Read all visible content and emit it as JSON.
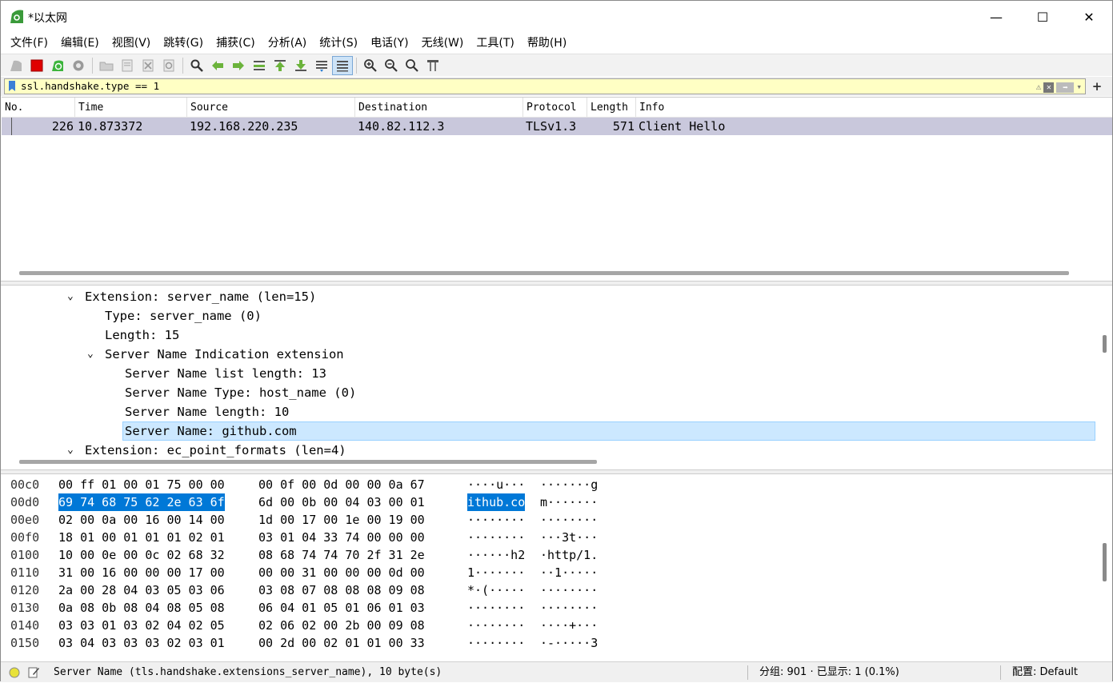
{
  "window": {
    "title": "*以太网",
    "minimize": "—",
    "maximize": "☐",
    "close": "✕"
  },
  "menu": [
    "文件(F)",
    "编辑(E)",
    "视图(V)",
    "跳转(G)",
    "捕获(C)",
    "分析(A)",
    "统计(S)",
    "电话(Y)",
    "无线(W)",
    "工具(T)",
    "帮助(H)"
  ],
  "toolbar_icons": [
    "shark-fin-icon",
    "stop-icon",
    "restart-icon",
    "options-gear-icon",
    "open-folder-icon",
    "save-file-icon",
    "close-file-icon",
    "reload-icon",
    "find-icon",
    "back-arrow-icon",
    "forward-arrow-icon",
    "goto-packet-icon",
    "first-packet-icon",
    "last-packet-icon",
    "autoscroll-icon",
    "colorize-icon",
    "zoom-in-icon",
    "zoom-out-icon",
    "zoom-normal-icon",
    "resize-columns-icon"
  ],
  "filter": {
    "value": "ssl.handshake.type == 1"
  },
  "packet_list": {
    "columns": [
      "No.",
      "Time",
      "Source",
      "Destination",
      "Protocol",
      "Length",
      "Info"
    ],
    "rows": [
      {
        "no": "226",
        "time": "10.873372",
        "source": "192.168.220.235",
        "destination": "140.82.112.3",
        "protocol": "TLSv1.3",
        "length": "571",
        "info": "Client Hello"
      }
    ]
  },
  "details": [
    {
      "text": "Extension: server_name (len=15)",
      "expanded": true
    },
    {
      "text": "Type: server_name (0)"
    },
    {
      "text": "Length: 15"
    },
    {
      "text": "Server Name Indication extension",
      "expanded": true
    },
    {
      "text": "Server Name list length: 13"
    },
    {
      "text": "Server Name Type: host_name (0)"
    },
    {
      "text": "Server Name length: 10"
    },
    {
      "text": "Server Name: github.com",
      "selected": true
    },
    {
      "text": "Extension: ec_point_formats (len=4)",
      "expanded": true
    }
  ],
  "hex": {
    "offsets": [
      "00c0",
      "00d0",
      "00e0",
      "00f0",
      "0100",
      "0110",
      "0120",
      "0130",
      "0140",
      "0150"
    ],
    "bytes1": [
      "00 ff 01 00 01 75 00 00",
      "69 74 68 75 62 2e 63 6f",
      "02 00 0a 00 16 00 14 00",
      "18 01 00 01 01 01 02 01",
      "10 00 0e 00 0c 02 68 32",
      "31 00 16 00 00 00 17 00",
      "2a 00 28 04 03 05 03 06",
      "0a 08 0b 08 04 08 05 08",
      "03 03 01 03 02 04 02 05",
      "03 04 03 03 03 02 03 01"
    ],
    "bytes2": [
      "00 0f 00 0d 00 00 0a 67",
      "6d 00 0b 00 04 03 00 01",
      "1d 00 17 00 1e 00 19 00",
      "03 01 04 33 74 00 00 00",
      "08 68 74 74 70 2f 31 2e",
      "00 00 31 00 00 00 0d 00",
      "03 08 07 08 08 08 09 08",
      "06 04 01 05 01 06 01 03",
      "02 06 02 00 2b 00 09 08",
      "00 2d 00 02 01 01 00 33"
    ],
    "ascii1": [
      "····u···",
      "ithub.co",
      "········",
      "········",
      "······h2",
      "1·······",
      "*·(·····",
      "········",
      "········",
      "········"
    ],
    "ascii2": [
      "·······g",
      "m·······",
      "········",
      "···3t···",
      "·http/1.",
      "··1·····",
      "········",
      "········",
      "····+···",
      "·-·····3"
    ]
  },
  "status": {
    "field": "Server Name (tls.handshake.extensions_server_name), 10 byte(s)",
    "packets": "分组: 901 · 已显示: 1 (0.1%)",
    "profile": "配置: Default"
  }
}
